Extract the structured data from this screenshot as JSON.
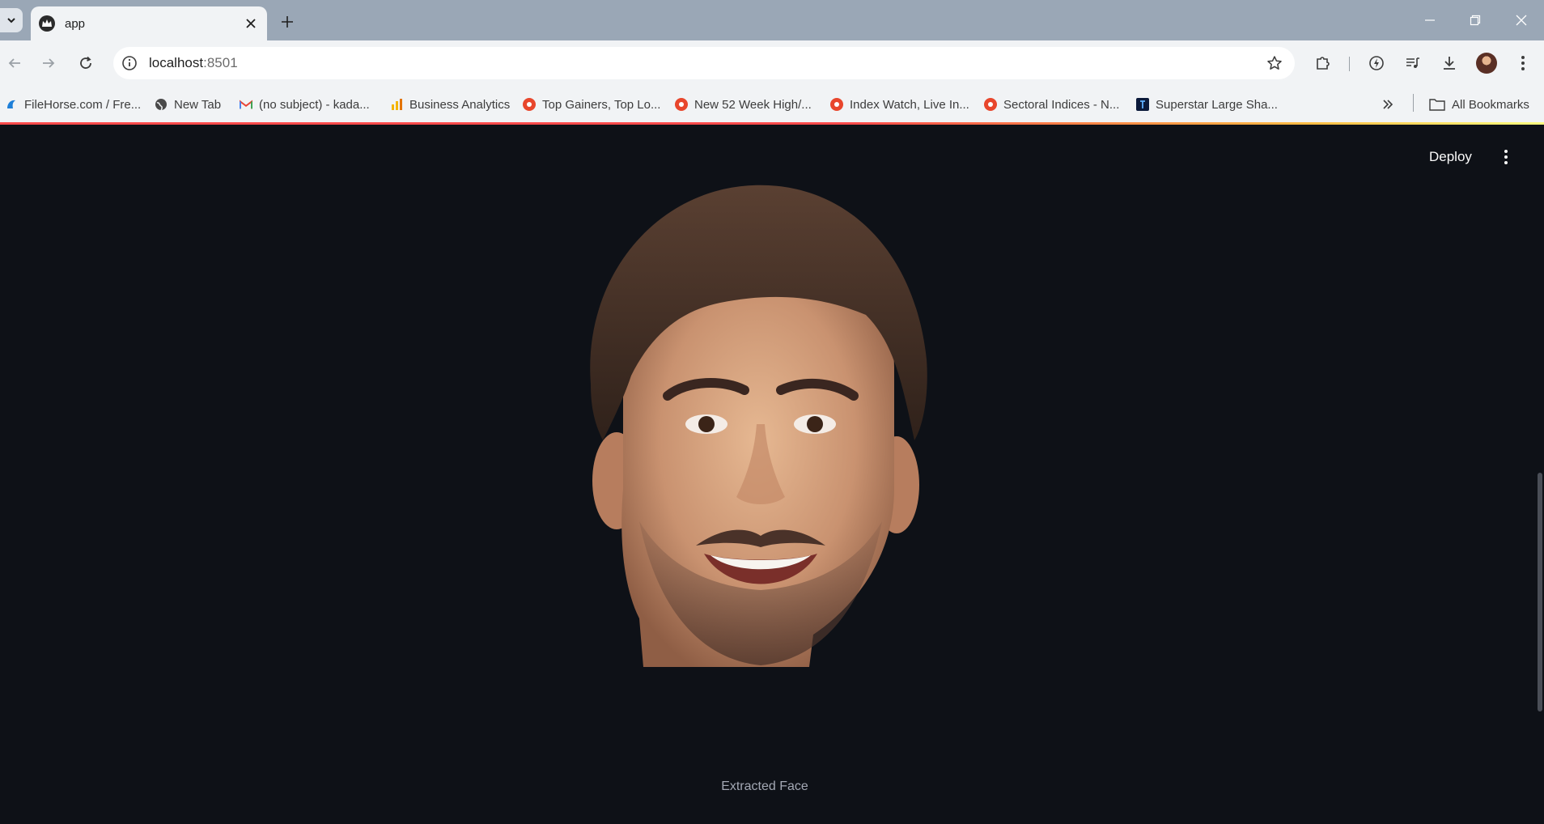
{
  "browser": {
    "tab": {
      "title": "app",
      "favicon": "streamlit-crown-icon"
    },
    "address": {
      "host": "localhost",
      "port": ":8501"
    },
    "bookmarks": [
      {
        "label": "FileHorse.com / Fre...",
        "icon": "filehorse-icon"
      },
      {
        "label": "New Tab",
        "icon": "globe-icon"
      },
      {
        "label": "(no subject) - kada...",
        "icon": "gmail-icon"
      },
      {
        "label": "Business Analytics",
        "icon": "analytics-icon"
      },
      {
        "label": "Top Gainers, Top Lo...",
        "icon": "red-site-icon"
      },
      {
        "label": "New 52 Week High/...",
        "icon": "red-site-icon"
      },
      {
        "label": "Index Watch, Live In...",
        "icon": "red-site-icon"
      },
      {
        "label": "Sectoral Indices - N...",
        "icon": "red-site-icon"
      },
      {
        "label": "Superstar Large Sha...",
        "icon": "dark-site-icon"
      }
    ],
    "all_bookmarks": "All Bookmarks"
  },
  "app": {
    "deploy_label": "Deploy",
    "image_caption": "Extracted Face",
    "colors": {
      "background": "#0e1117",
      "text": "#fafafa",
      "caption": "#a3a8b4"
    }
  }
}
